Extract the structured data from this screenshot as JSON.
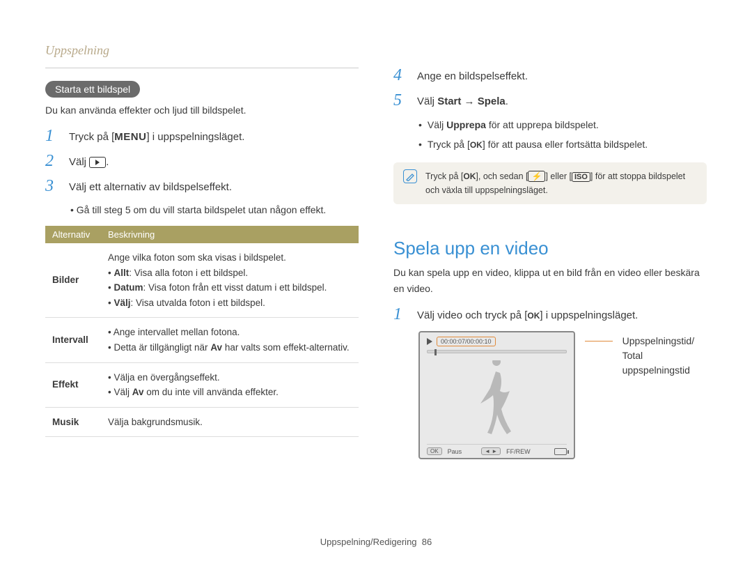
{
  "header": "Uppspelning",
  "left": {
    "pill": "Starta ett bildspel",
    "intro": "Du kan använda effekter och ljud till bildspelet.",
    "steps": {
      "s1a": "Tryck på [",
      "s1_menu": "MENU",
      "s1b": "] i uppspelningsläget.",
      "s2": "Välj ",
      "s3": "Välj ett alternativ av bildspelseffekt.",
      "s3_sub": "Gå till steg 5 om du vill starta bildspelet utan någon effekt."
    },
    "table": {
      "th1": "Alternativ",
      "th2": "Beskrivning",
      "r1": {
        "name": "Bilder",
        "l0": "Ange vilka foton som ska visas i bildspelet.",
        "l1b": "Allt",
        "l1": ": Visa alla foton i ett bildspel.",
        "l2b": "Datum",
        "l2": ": Visa foton från ett visst datum i ett bildspel.",
        "l3b": "Välj",
        "l3": ": Visa utvalda foton i ett bildspel."
      },
      "r2": {
        "name": "Intervall",
        "l0": "Ange intervallet mellan fotona.",
        "l1a": "Detta är tillgängligt när ",
        "l1b": "Av",
        "l1c": " har valts som effekt-alternativ."
      },
      "r3": {
        "name": "Effekt",
        "l0": "Välja en övergångseffekt.",
        "l1a": "Välj ",
        "l1b": "Av",
        "l1c": " om du inte vill använda effekter."
      },
      "r4": {
        "name": "Musik",
        "l0": "Välja bakgrundsmusik."
      }
    }
  },
  "right": {
    "s4": "Ange en bildspelseffekt.",
    "s5a": "Välj ",
    "s5b": "Start",
    "s5arrow": " → ",
    "s5c": "Spela",
    "s5d": ".",
    "sub1a": "Välj ",
    "sub1b": "Upprepa",
    "sub1c": " för att upprepa bildspelet.",
    "sub2a": "Tryck på [",
    "sub2_ok": "OK",
    "sub2b": "] för att pausa eller fortsätta bildspelet.",
    "note_a": "Tryck på [",
    "note_ok": "OK",
    "note_b": "], och sedan [",
    "note_flash": "⯈",
    "note_c": "] eller [",
    "note_iso": "ISO",
    "note_d": "] för att stoppa bildspelet och växla till uppspelningsläget.",
    "h2": "Spela upp en video",
    "desc": "Du kan spela upp en video, klippa ut en bild från en video eller beskära en video.",
    "v1a": "Välj video och tryck på [",
    "v1_ok": "OK",
    "v1b": "] i uppspelningsläget.",
    "time": "00:00:07/00:00:10",
    "lcd_paus": "Paus",
    "lcd_ok": "OK",
    "lcd_lr": "◄ ►",
    "lcd_ff": "FF/REW",
    "callout": "Uppspelningstid/\nTotal uppspelningstid"
  },
  "footer": {
    "text": "Uppspelning/Redigering",
    "page": "86"
  }
}
